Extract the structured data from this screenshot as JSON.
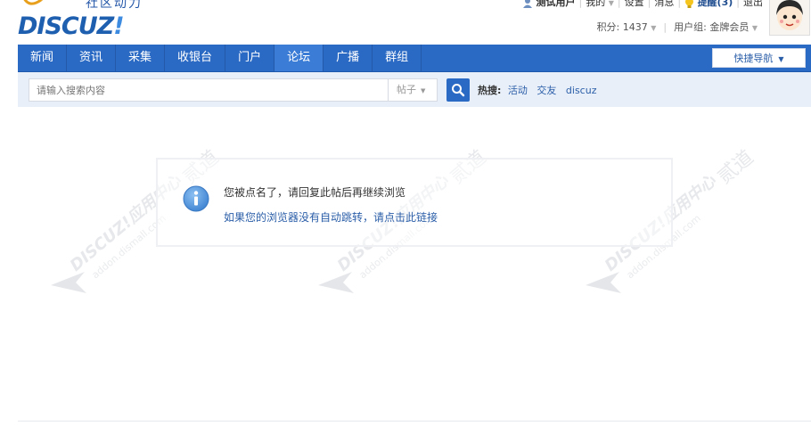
{
  "brand": {
    "subtitle": "社区动力",
    "name": "DISCUZ",
    "mark": "!",
    "color": "#1f5fb0"
  },
  "user_links": {
    "username": "测试用户",
    "mine": "我的",
    "settings": "设置",
    "messages": "消息",
    "reminder": "提醒(3)",
    "logout": "退出"
  },
  "user_info": {
    "points": "积分: 1437",
    "group": "用户组: 金牌会员"
  },
  "nav": {
    "items": [
      {
        "label": "新闻"
      },
      {
        "label": "资讯"
      },
      {
        "label": "采集"
      },
      {
        "label": "收银台"
      },
      {
        "label": "门户"
      },
      {
        "label": "论坛"
      },
      {
        "label": "广播"
      },
      {
        "label": "群组"
      }
    ],
    "active_index": 5,
    "quicknav": "快捷导航",
    "color": "#2b6ac4"
  },
  "search": {
    "placeholder": "请输入搜索内容",
    "type": "帖子",
    "hot_label": "热搜:",
    "hot_terms": [
      "活动",
      "交友",
      "discuz"
    ]
  },
  "message": {
    "text": "您被点名了，请回复此帖后再继续浏览",
    "link": "如果您的浏览器没有自动跳转，请点击此链接"
  },
  "watermark": {
    "line1": "DISCUZ!应用中心",
    "line2": "addon.dismall.com",
    "line3": "贰道"
  }
}
